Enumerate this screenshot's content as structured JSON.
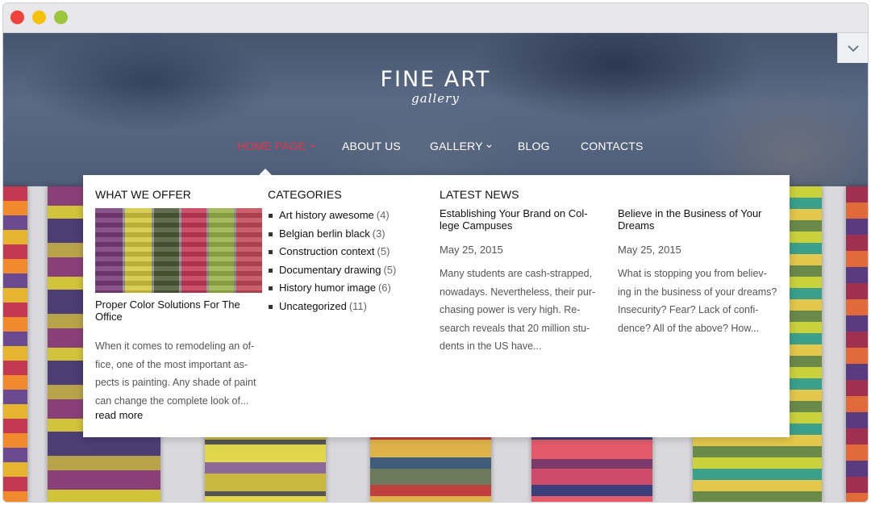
{
  "browser": {
    "controls": [
      "close",
      "minimize",
      "zoom"
    ]
  },
  "logo": {
    "title": "FINE ART",
    "subtitle": "gallery"
  },
  "nav": [
    {
      "label": "HOME PAGE",
      "has_dropdown": true,
      "active": true
    },
    {
      "label": "ABOUT US",
      "has_dropdown": false
    },
    {
      "label": "GALLERY",
      "has_dropdown": true
    },
    {
      "label": "BLOG",
      "has_dropdown": false
    },
    {
      "label": "CONTACTS",
      "has_dropdown": false
    }
  ],
  "colors": {
    "active_nav": "#e5334a",
    "menu_bg": "#ffffff"
  },
  "mega_menu": {
    "offer": {
      "heading": "WHAT WE OFFER",
      "post_title": "Proper Color Solutions For The Office",
      "excerpt_lines": [
        "When it comes to remodeling an of-",
        "fice, one of the most important as-",
        "pects is painting. Any shade of paint",
        "can change the complete look of..."
      ],
      "read_more": "read more"
    },
    "categories": {
      "heading": "CATEGORIES",
      "items": [
        {
          "label": "Art history awesome",
          "count": "(4)"
        },
        {
          "label": "Belgian berlin black",
          "count": "(3)"
        },
        {
          "label": "Construction context",
          "count": "(5)"
        },
        {
          "label": "Documentary drawing",
          "count": "(5)"
        },
        {
          "label": "History humor image",
          "count": "(6)"
        },
        {
          "label": "Uncategorized",
          "count": "(11)"
        }
      ]
    },
    "news": {
      "heading": "LATEST NEWS",
      "items": [
        {
          "title_lines": [
            "Establishing Your Brand on Col-",
            "lege Campuses"
          ],
          "date": "May 25, 2015",
          "excerpt_lines": [
            "Many students are cash-strapped,",
            "nowadays. Nevertheless, their pur-",
            "chasing power is very high. Re-",
            "search reveals that 20 million stu-",
            "dents in the US have..."
          ]
        },
        {
          "title_lines": [
            "Believe in the Business of Your",
            "Dreams"
          ],
          "date": "May 25, 2015",
          "excerpt_lines": [
            "What is stopping you from believ-",
            "ing in the business of your dreams?",
            "Insecurity? Fear? Lack of confi-",
            "dence? All of the above? How..."
          ]
        }
      ]
    }
  }
}
